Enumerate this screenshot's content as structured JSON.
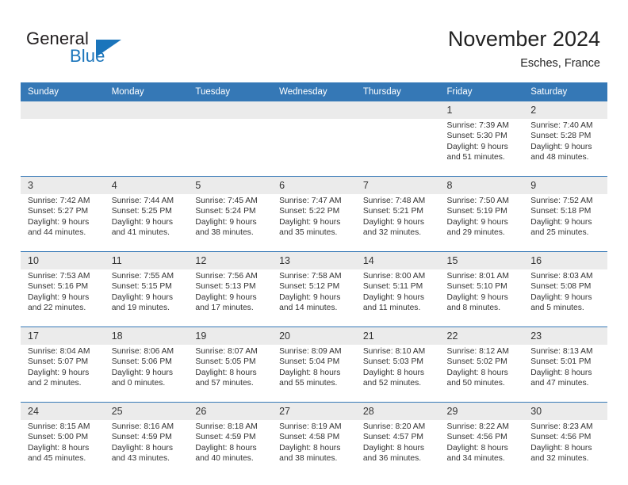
{
  "brand": {
    "word_general": "General",
    "word_blue": "Blue",
    "triangle_color": "#1b75bb"
  },
  "header": {
    "title": "November 2024",
    "location": "Esches, France",
    "header_bg": "#3578b6",
    "daynum_bg": "#ebebeb"
  },
  "weekdays": [
    "Sunday",
    "Monday",
    "Tuesday",
    "Wednesday",
    "Thursday",
    "Friday",
    "Saturday"
  ],
  "weeks": [
    {
      "days": [
        {
          "num": "",
          "sunrise": "",
          "sunset": "",
          "daylight1": "",
          "daylight2": ""
        },
        {
          "num": "",
          "sunrise": "",
          "sunset": "",
          "daylight1": "",
          "daylight2": ""
        },
        {
          "num": "",
          "sunrise": "",
          "sunset": "",
          "daylight1": "",
          "daylight2": ""
        },
        {
          "num": "",
          "sunrise": "",
          "sunset": "",
          "daylight1": "",
          "daylight2": ""
        },
        {
          "num": "",
          "sunrise": "",
          "sunset": "",
          "daylight1": "",
          "daylight2": ""
        },
        {
          "num": "1",
          "sunrise": "Sunrise: 7:39 AM",
          "sunset": "Sunset: 5:30 PM",
          "daylight1": "Daylight: 9 hours",
          "daylight2": "and 51 minutes."
        },
        {
          "num": "2",
          "sunrise": "Sunrise: 7:40 AM",
          "sunset": "Sunset: 5:28 PM",
          "daylight1": "Daylight: 9 hours",
          "daylight2": "and 48 minutes."
        }
      ]
    },
    {
      "days": [
        {
          "num": "3",
          "sunrise": "Sunrise: 7:42 AM",
          "sunset": "Sunset: 5:27 PM",
          "daylight1": "Daylight: 9 hours",
          "daylight2": "and 44 minutes."
        },
        {
          "num": "4",
          "sunrise": "Sunrise: 7:44 AM",
          "sunset": "Sunset: 5:25 PM",
          "daylight1": "Daylight: 9 hours",
          "daylight2": "and 41 minutes."
        },
        {
          "num": "5",
          "sunrise": "Sunrise: 7:45 AM",
          "sunset": "Sunset: 5:24 PM",
          "daylight1": "Daylight: 9 hours",
          "daylight2": "and 38 minutes."
        },
        {
          "num": "6",
          "sunrise": "Sunrise: 7:47 AM",
          "sunset": "Sunset: 5:22 PM",
          "daylight1": "Daylight: 9 hours",
          "daylight2": "and 35 minutes."
        },
        {
          "num": "7",
          "sunrise": "Sunrise: 7:48 AM",
          "sunset": "Sunset: 5:21 PM",
          "daylight1": "Daylight: 9 hours",
          "daylight2": "and 32 minutes."
        },
        {
          "num": "8",
          "sunrise": "Sunrise: 7:50 AM",
          "sunset": "Sunset: 5:19 PM",
          "daylight1": "Daylight: 9 hours",
          "daylight2": "and 29 minutes."
        },
        {
          "num": "9",
          "sunrise": "Sunrise: 7:52 AM",
          "sunset": "Sunset: 5:18 PM",
          "daylight1": "Daylight: 9 hours",
          "daylight2": "and 25 minutes."
        }
      ]
    },
    {
      "days": [
        {
          "num": "10",
          "sunrise": "Sunrise: 7:53 AM",
          "sunset": "Sunset: 5:16 PM",
          "daylight1": "Daylight: 9 hours",
          "daylight2": "and 22 minutes."
        },
        {
          "num": "11",
          "sunrise": "Sunrise: 7:55 AM",
          "sunset": "Sunset: 5:15 PM",
          "daylight1": "Daylight: 9 hours",
          "daylight2": "and 19 minutes."
        },
        {
          "num": "12",
          "sunrise": "Sunrise: 7:56 AM",
          "sunset": "Sunset: 5:13 PM",
          "daylight1": "Daylight: 9 hours",
          "daylight2": "and 17 minutes."
        },
        {
          "num": "13",
          "sunrise": "Sunrise: 7:58 AM",
          "sunset": "Sunset: 5:12 PM",
          "daylight1": "Daylight: 9 hours",
          "daylight2": "and 14 minutes."
        },
        {
          "num": "14",
          "sunrise": "Sunrise: 8:00 AM",
          "sunset": "Sunset: 5:11 PM",
          "daylight1": "Daylight: 9 hours",
          "daylight2": "and 11 minutes."
        },
        {
          "num": "15",
          "sunrise": "Sunrise: 8:01 AM",
          "sunset": "Sunset: 5:10 PM",
          "daylight1": "Daylight: 9 hours",
          "daylight2": "and 8 minutes."
        },
        {
          "num": "16",
          "sunrise": "Sunrise: 8:03 AM",
          "sunset": "Sunset: 5:08 PM",
          "daylight1": "Daylight: 9 hours",
          "daylight2": "and 5 minutes."
        }
      ]
    },
    {
      "days": [
        {
          "num": "17",
          "sunrise": "Sunrise: 8:04 AM",
          "sunset": "Sunset: 5:07 PM",
          "daylight1": "Daylight: 9 hours",
          "daylight2": "and 2 minutes."
        },
        {
          "num": "18",
          "sunrise": "Sunrise: 8:06 AM",
          "sunset": "Sunset: 5:06 PM",
          "daylight1": "Daylight: 9 hours",
          "daylight2": "and 0 minutes."
        },
        {
          "num": "19",
          "sunrise": "Sunrise: 8:07 AM",
          "sunset": "Sunset: 5:05 PM",
          "daylight1": "Daylight: 8 hours",
          "daylight2": "and 57 minutes."
        },
        {
          "num": "20",
          "sunrise": "Sunrise: 8:09 AM",
          "sunset": "Sunset: 5:04 PM",
          "daylight1": "Daylight: 8 hours",
          "daylight2": "and 55 minutes."
        },
        {
          "num": "21",
          "sunrise": "Sunrise: 8:10 AM",
          "sunset": "Sunset: 5:03 PM",
          "daylight1": "Daylight: 8 hours",
          "daylight2": "and 52 minutes."
        },
        {
          "num": "22",
          "sunrise": "Sunrise: 8:12 AM",
          "sunset": "Sunset: 5:02 PM",
          "daylight1": "Daylight: 8 hours",
          "daylight2": "and 50 minutes."
        },
        {
          "num": "23",
          "sunrise": "Sunrise: 8:13 AM",
          "sunset": "Sunset: 5:01 PM",
          "daylight1": "Daylight: 8 hours",
          "daylight2": "and 47 minutes."
        }
      ]
    },
    {
      "days": [
        {
          "num": "24",
          "sunrise": "Sunrise: 8:15 AM",
          "sunset": "Sunset: 5:00 PM",
          "daylight1": "Daylight: 8 hours",
          "daylight2": "and 45 minutes."
        },
        {
          "num": "25",
          "sunrise": "Sunrise: 8:16 AM",
          "sunset": "Sunset: 4:59 PM",
          "daylight1": "Daylight: 8 hours",
          "daylight2": "and 43 minutes."
        },
        {
          "num": "26",
          "sunrise": "Sunrise: 8:18 AM",
          "sunset": "Sunset: 4:59 PM",
          "daylight1": "Daylight: 8 hours",
          "daylight2": "and 40 minutes."
        },
        {
          "num": "27",
          "sunrise": "Sunrise: 8:19 AM",
          "sunset": "Sunset: 4:58 PM",
          "daylight1": "Daylight: 8 hours",
          "daylight2": "and 38 minutes."
        },
        {
          "num": "28",
          "sunrise": "Sunrise: 8:20 AM",
          "sunset": "Sunset: 4:57 PM",
          "daylight1": "Daylight: 8 hours",
          "daylight2": "and 36 minutes."
        },
        {
          "num": "29",
          "sunrise": "Sunrise: 8:22 AM",
          "sunset": "Sunset: 4:56 PM",
          "daylight1": "Daylight: 8 hours",
          "daylight2": "and 34 minutes."
        },
        {
          "num": "30",
          "sunrise": "Sunrise: 8:23 AM",
          "sunset": "Sunset: 4:56 PM",
          "daylight1": "Daylight: 8 hours",
          "daylight2": "and 32 minutes."
        }
      ]
    }
  ]
}
